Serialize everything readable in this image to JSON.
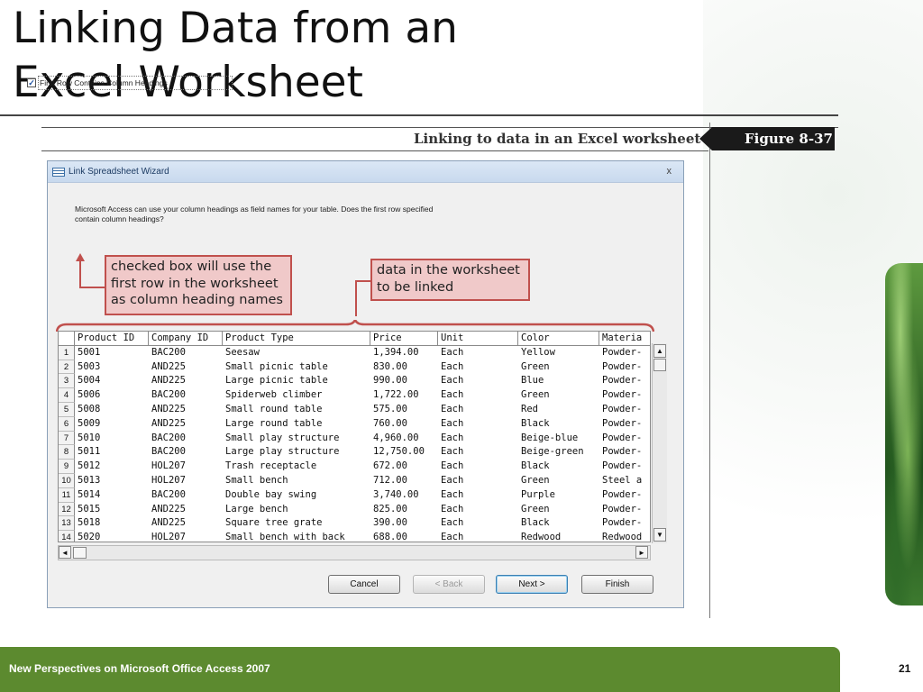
{
  "slide": {
    "title_line1": "Linking Data from an",
    "title_line2": "Excel Worksheet",
    "footer": "New Perspectives on Microsoft Office Access 2007",
    "page_number": "21"
  },
  "figure": {
    "caption": "Linking to data in an Excel worksheet",
    "label": "Figure 8-37"
  },
  "wizard": {
    "title": "Link Spreadsheet Wizard",
    "close_glyph": "x",
    "intro": "Microsoft Access can use your column headings as field names for your table. Does the first row specified contain column headings?",
    "checkbox_label": "First Row Contains Column Headings",
    "checkbox_checked": true,
    "checkbox_glyph": "✓",
    "buttons": {
      "cancel": "Cancel",
      "back": "< Back",
      "next": "Next >",
      "finish": "Finish"
    },
    "scroll": {
      "up": "▲",
      "down": "▼",
      "left": "◄",
      "right": "►"
    }
  },
  "callouts": {
    "checkbox_note": "checked box will use the first row in the worksheet as column heading names",
    "data_note": "data in the worksheet to be linked"
  },
  "grid": {
    "columns": [
      "Product ID",
      "Company ID",
      "Product Type",
      "Price",
      "Unit",
      "Color",
      "Materia"
    ],
    "rows": [
      [
        "1",
        "5001",
        "BAC200",
        "Seesaw",
        "1,394.00",
        "Each",
        "Yellow",
        "Powder-"
      ],
      [
        "2",
        "5003",
        "AND225",
        "Small picnic table",
        "830.00",
        "Each",
        "Green",
        "Powder-"
      ],
      [
        "3",
        "5004",
        "AND225",
        "Large picnic table",
        "990.00",
        "Each",
        "Blue",
        "Powder-"
      ],
      [
        "4",
        "5006",
        "BAC200",
        "Spiderweb climber",
        "1,722.00",
        "Each",
        "Green",
        "Powder-"
      ],
      [
        "5",
        "5008",
        "AND225",
        "Small round table",
        "575.00",
        "Each",
        "Red",
        "Powder-"
      ],
      [
        "6",
        "5009",
        "AND225",
        "Large round table",
        "760.00",
        "Each",
        "Black",
        "Powder-"
      ],
      [
        "7",
        "5010",
        "BAC200",
        "Small play structure",
        "4,960.00",
        "Each",
        "Beige-blue",
        "Powder-"
      ],
      [
        "8",
        "5011",
        "BAC200",
        "Large play structure",
        "12,750.00",
        "Each",
        "Beige-green",
        "Powder-"
      ],
      [
        "9",
        "5012",
        "HOL207",
        "Trash receptacle",
        "672.00",
        "Each",
        "Black",
        "Powder-"
      ],
      [
        "10",
        "5013",
        "HOL207",
        "Small bench",
        "712.00",
        "Each",
        "Green",
        "Steel a"
      ],
      [
        "11",
        "5014",
        "BAC200",
        "Double bay swing",
        "3,740.00",
        "Each",
        "Purple",
        "Powder-"
      ],
      [
        "12",
        "5015",
        "AND225",
        "Large bench",
        "825.00",
        "Each",
        "Green",
        "Powder-"
      ],
      [
        "13",
        "5018",
        "AND225",
        "Square tree grate",
        "390.00",
        "Each",
        "Black",
        "Powder-"
      ],
      [
        "14",
        "5020",
        "HOL207",
        "Small bench with back",
        "688.00",
        "Each",
        "Redwood",
        "Redwood"
      ]
    ]
  },
  "colors": {
    "footer_green": "#5c8a2f",
    "callout_fill": "#f0c9c9",
    "callout_border": "#c0504d"
  }
}
